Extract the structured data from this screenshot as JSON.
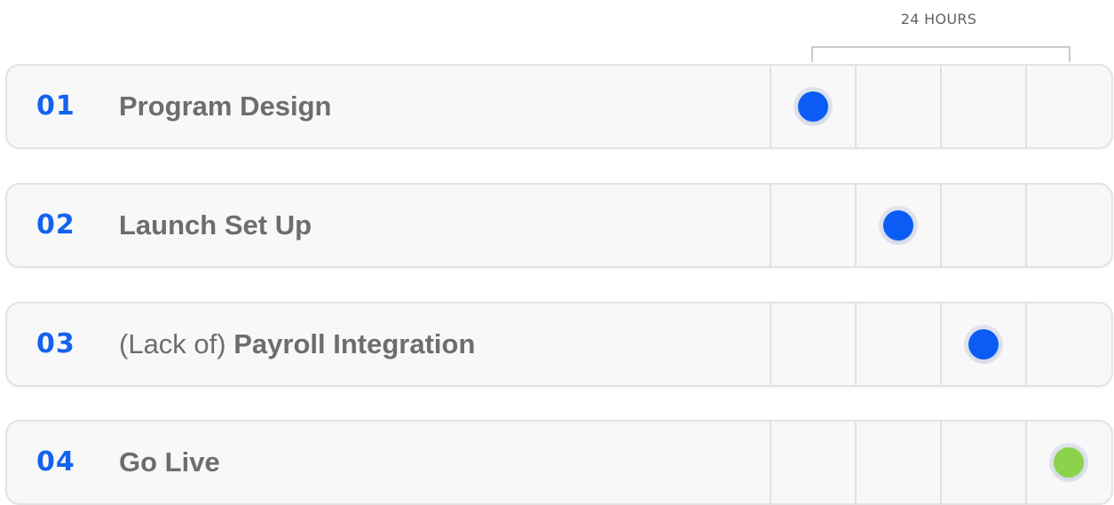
{
  "header": {
    "hours_label": "24 HOURS"
  },
  "colors": {
    "accent": "#1462f0",
    "dot_blue": "#0a5cf5",
    "dot_green": "#8cd24a",
    "title_text": "#6d6d6d"
  },
  "rows": [
    {
      "number": "01",
      "prefix": "",
      "title": "Program Design",
      "dot_column": 1,
      "dot_color": "blue"
    },
    {
      "number": "02",
      "prefix": "",
      "title": "Launch Set Up",
      "dot_column": 2,
      "dot_color": "blue"
    },
    {
      "number": "03",
      "prefix": "(Lack of) ",
      "title": "Payroll Integration",
      "dot_column": 3,
      "dot_color": "blue"
    },
    {
      "number": "04",
      "prefix": "",
      "title": "Go Live",
      "dot_column": 4,
      "dot_color": "green"
    }
  ]
}
